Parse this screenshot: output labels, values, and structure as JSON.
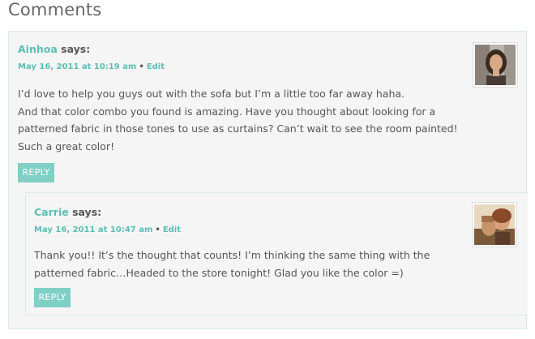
{
  "section_title": "Comments",
  "comments": [
    {
      "author": "Ainhoa",
      "says": "says:",
      "date": "May 16, 2011 at 10:19 am",
      "separator": "•",
      "edit": "Edit",
      "lines": [
        "I’d love to help you guys out with the sofa but I’m a little too far away haha.",
        "And that color combo you found is amazing. Have you thought about looking for a",
        "patterned fabric in those tones to use as curtains? Can’t wait to see the room painted!",
        "Such a great color!"
      ],
      "reply": "REPLY"
    },
    {
      "author": "Carrie",
      "says": "says:",
      "date": "May 16, 2011 at 10:47 am",
      "separator": "•",
      "edit": "Edit",
      "lines": [
        "Thank you!! It’s the thought that counts! I’m thinking the same thing with the",
        "patterned fabric…Headed to the store tonight! Glad you like the color =)"
      ],
      "reply": "REPLY"
    }
  ],
  "colors": {
    "accent": "#5ebdb3",
    "button": "#7fcfc5",
    "panel": "#f5f5f5",
    "border": "#d9ebe8"
  }
}
